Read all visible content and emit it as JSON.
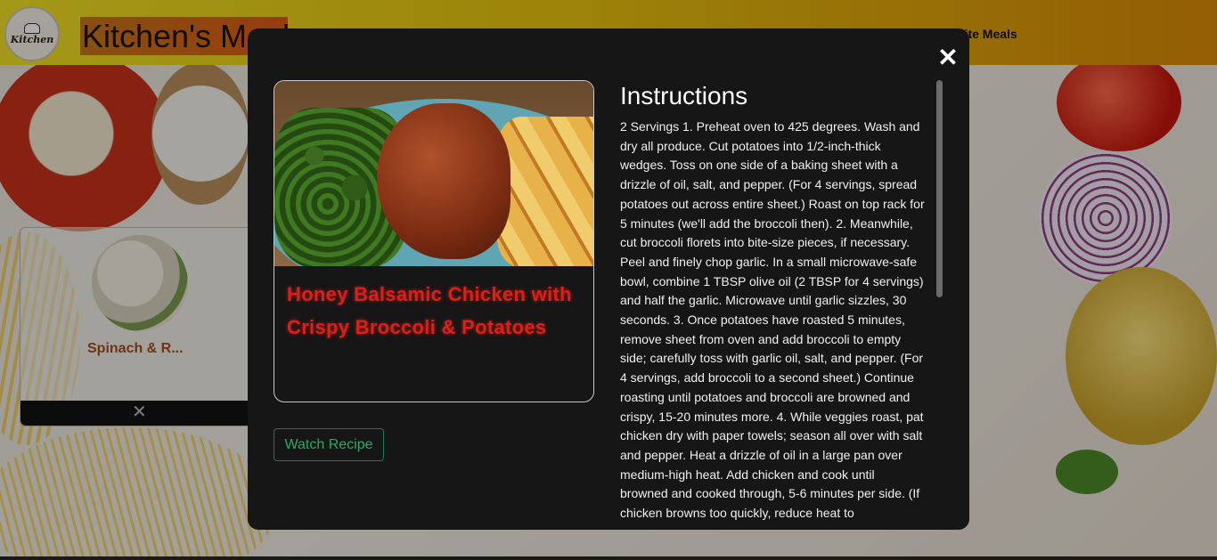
{
  "header": {
    "brand": "Kitchen's Meal",
    "logo_text": "Kitchen",
    "nav_favourites": "ourite Meals"
  },
  "card": {
    "title": "Spinach & R...",
    "close_icon": "✕"
  },
  "modal": {
    "close_icon": "✕",
    "recipe_title": "Honey Balsamic Chicken with Crispy Broccoli & Potatoes",
    "watch_button": "Watch Recipe",
    "instructions_heading": "Instructions",
    "instructions_text": "2 Servings 1. Preheat oven to 425 degrees. Wash and dry all produce. Cut potatoes into 1/2-inch-thick wedges. Toss on one side of a baking sheet with a drizzle of oil, salt, and pepper. (For 4 servings, spread potatoes out across entire sheet.) Roast on top rack for 5 minutes (we'll add the broccoli then). 2. Meanwhile, cut broccoli florets into bite-size pieces, if necessary. Peel and finely chop garlic. In a small microwave-safe bowl, combine 1 TBSP olive oil (2 TBSP for 4 servings) and half the garlic. Microwave until garlic sizzles, 30 seconds. 3. Once potatoes have roasted 5 minutes, remove sheet from oven and add broccoli to empty side; carefully toss with garlic oil, salt, and pepper. (For 4 servings, add broccoli to a second sheet.) Continue roasting until potatoes and broccoli are browned and crispy, 15-20 minutes more. 4. While veggies roast, pat chicken dry with paper towels; season all over with salt and pepper. Heat a drizzle of oil in a large pan over medium-high heat. Add chicken and cook until browned and cooked through, 5-6 minutes per side. (If chicken browns too quickly, reduce heat to"
  },
  "colors": {
    "accent_red": "#d9201a",
    "watch_green": "#2fa86a",
    "header_yellow": "#f1e125",
    "header_orange": "#d98a06"
  }
}
